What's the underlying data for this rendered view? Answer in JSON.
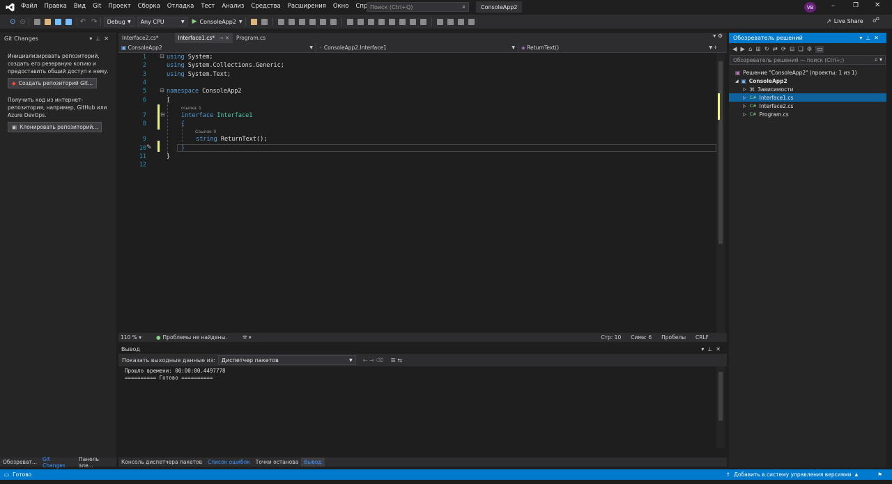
{
  "window": {
    "menu": [
      "Файл",
      "Правка",
      "Вид",
      "Git",
      "Проект",
      "Сборка",
      "Отладка",
      "Тест",
      "Анализ",
      "Средства",
      "Расширения",
      "Окно",
      "Справка"
    ],
    "search_placeholder": "Поиск (Ctrl+Q)",
    "solution_name": "ConsoleApp2",
    "avatar": "VB",
    "live_share": "Live Share"
  },
  "toolbar": {
    "config": "Debug",
    "platform": "Any CPU",
    "start_target": "ConsoleApp2"
  },
  "git_changes": {
    "title": "Git Changes",
    "init_text": "Инициализировать репозиторий, создать его резервную копию и предоставить общий доступ к нему.",
    "create_button": "Создать репозиторий Git...",
    "clone_text": "Получить код из интернет-репозитория, например, GitHub или Azure DevOps.",
    "clone_button": "Клонировать репозиторий..."
  },
  "editor": {
    "tabs": [
      {
        "label": "Interface2.cs*"
      },
      {
        "label": "Interface1.cs*"
      },
      {
        "label": "Program.cs"
      }
    ],
    "nav": {
      "project": "ConsoleApp2",
      "type": "ConsoleApp2.Interface1",
      "member": "ReturnText()"
    },
    "lines": [
      {
        "n": "1",
        "html": "<span class='kw'>using</span> System;",
        "indent": 0
      },
      {
        "n": "2",
        "html": "<span class='kw'>using</span> System.Collections.Generic;",
        "indent": 0
      },
      {
        "n": "3",
        "html": "<span class='kw'>using</span> System.Text;",
        "indent": 0
      },
      {
        "n": "4",
        "html": "",
        "indent": 0
      },
      {
        "n": "5",
        "html": "<span class='kw'>namespace</span> ConsoleApp2",
        "indent": 0
      },
      {
        "n": "6",
        "html": "{",
        "indent": 0
      },
      {
        "n": "7",
        "html": "<span class='kw'>interface</span> <span class='ty'>Interface1</span>",
        "indent": 1
      },
      {
        "n": "8",
        "html": "<span style='color:#569cd6'>{</span>",
        "indent": 1
      },
      {
        "n": "9",
        "html": "<span class='kw'>string</span> ReturnText();",
        "indent": 2
      },
      {
        "n": "10",
        "html": "<span style='color:#569cd6'>}</span>",
        "indent": 1
      },
      {
        "n": "11",
        "html": "}",
        "indent": 0
      },
      {
        "n": "12",
        "html": "",
        "indent": 0
      }
    ],
    "hint_interface": "ссылка: 1",
    "hint_method": "Ссылок: 0",
    "zoom": "110 %",
    "problems": "Проблемы не найдены.",
    "line": "Стр: 10",
    "col": "Симв: 6",
    "spaces": "Пробелы",
    "eol": "CRLF"
  },
  "output": {
    "title": "Вывод",
    "show_from_label": "Показать выходные данные из:",
    "source": "Диспетчер пакетов",
    "lines": [
      "Прошло времени: 00:00:00.4497778",
      "========== Готово =========="
    ]
  },
  "bottom_tabs": [
    "Консоль диспетчера пакетов",
    "Список ошибок",
    "Точки останова",
    "Вывод"
  ],
  "left_tabs": [
    "Обозреват...",
    "Git Changes",
    "Панель эле..."
  ],
  "solution_explorer": {
    "title": "Обозреватель решений",
    "search_placeholder": "Обозреватель решений — поиск (Ctrl+;)",
    "solution": "Решение \"ConsoleApp2\" (проекты: 1 из 1)",
    "project": "ConsoleApp2",
    "items": [
      "Зависимости",
      "Interface1.cs",
      "Interface2.cs",
      "Program.cs"
    ]
  },
  "status": {
    "ready": "Готово",
    "vcs": "Добавить в систему управления версиями"
  },
  "colors": {
    "accent": "#007acc",
    "selection": "#0e639c",
    "modified_bar": "#f1f18c"
  }
}
